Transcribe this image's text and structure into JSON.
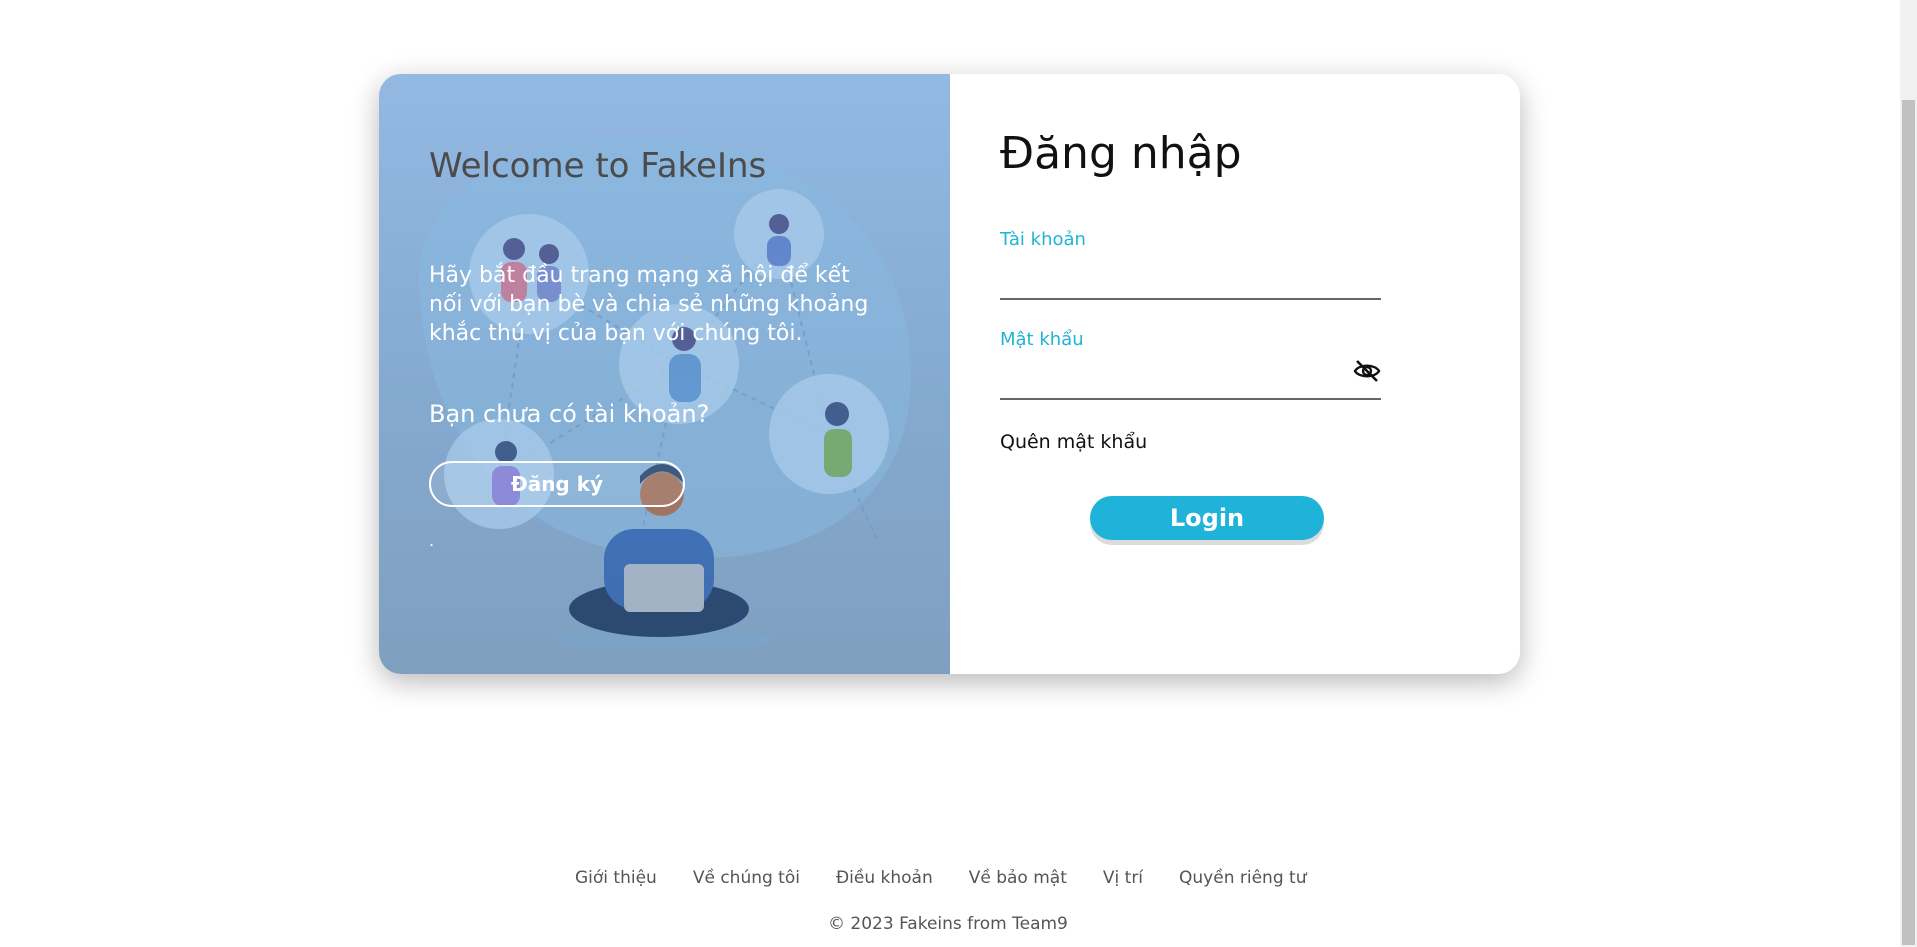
{
  "hero": {
    "title": "Welcome to FakeIns",
    "description": "Hãy bắt đầu trang mạng xã hội để kết nối với bạn bè và chia sẻ những khoảng khắc thú vị của bạn với chúng tôi.",
    "question": "Bạn chưa có tài khoản?",
    "register_label": "Đăng ký",
    "dot": "."
  },
  "login": {
    "title": "Đăng nhập",
    "username_label": "Tài khoản",
    "username_value": "",
    "password_label": "Mật khẩu",
    "password_value": "",
    "forgot_label": "Quên mật khẩu",
    "submit_label": "Login"
  },
  "footer": {
    "links": [
      "Giới thiệu",
      "Về chúng tôi",
      "Điều khoản",
      "Về bảo mật",
      "Vị trí",
      "Quyền riêng tư"
    ],
    "copyright": "© 2023 Fakeins from Team9"
  },
  "colors": {
    "accent": "#1fb3d9",
    "label_accent": "#1fb3d6",
    "hero_bg": "#93b9e3"
  },
  "icons": {
    "password_toggle": "eye-off-icon"
  }
}
